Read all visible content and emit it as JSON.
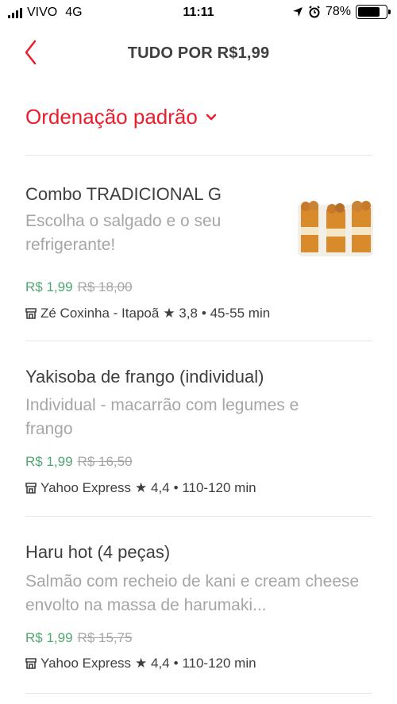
{
  "status_bar": {
    "carrier": "VIVO",
    "network": "4G",
    "time": "11:11",
    "battery": "78%",
    "battery_level": 0.78
  },
  "header": {
    "title": "TUDO POR R$1,99"
  },
  "sort": {
    "label": "Ordenação padrão"
  },
  "items": [
    {
      "name": "Combo TRADICIONAL G",
      "description": "Escolha o salgado e o seu refrigerante!",
      "price": "R$ 1,99",
      "old_price": "R$ 18,00",
      "store": "Zé Coxinha - Itapoã",
      "rating_text": "★ 3,8",
      "time_text": "• 45-55 min"
    },
    {
      "name": "Yakisoba de frango (individual)",
      "description": "Individual - macarrão com legumes e frango",
      "price": "R$ 1,99",
      "old_price": "R$ 16,50",
      "store": "Yahoo Express",
      "rating_text": "★ 4,4",
      "time_text": "• 110-120 min"
    },
    {
      "name": "Haru hot (4 peças)",
      "description": "Salmão com recheio de kani e cream cheese envolto na massa de harumaki...",
      "price": "R$ 1,99",
      "old_price": "R$ 15,75",
      "store": "Yahoo Express",
      "rating_text": "★ 4,4",
      "time_text": "• 110-120 min"
    }
  ],
  "colors": {
    "accent": "#ea1d2c",
    "price": "#50a773",
    "muted": "#a6a6a6",
    "text": "#3e3e3e"
  }
}
